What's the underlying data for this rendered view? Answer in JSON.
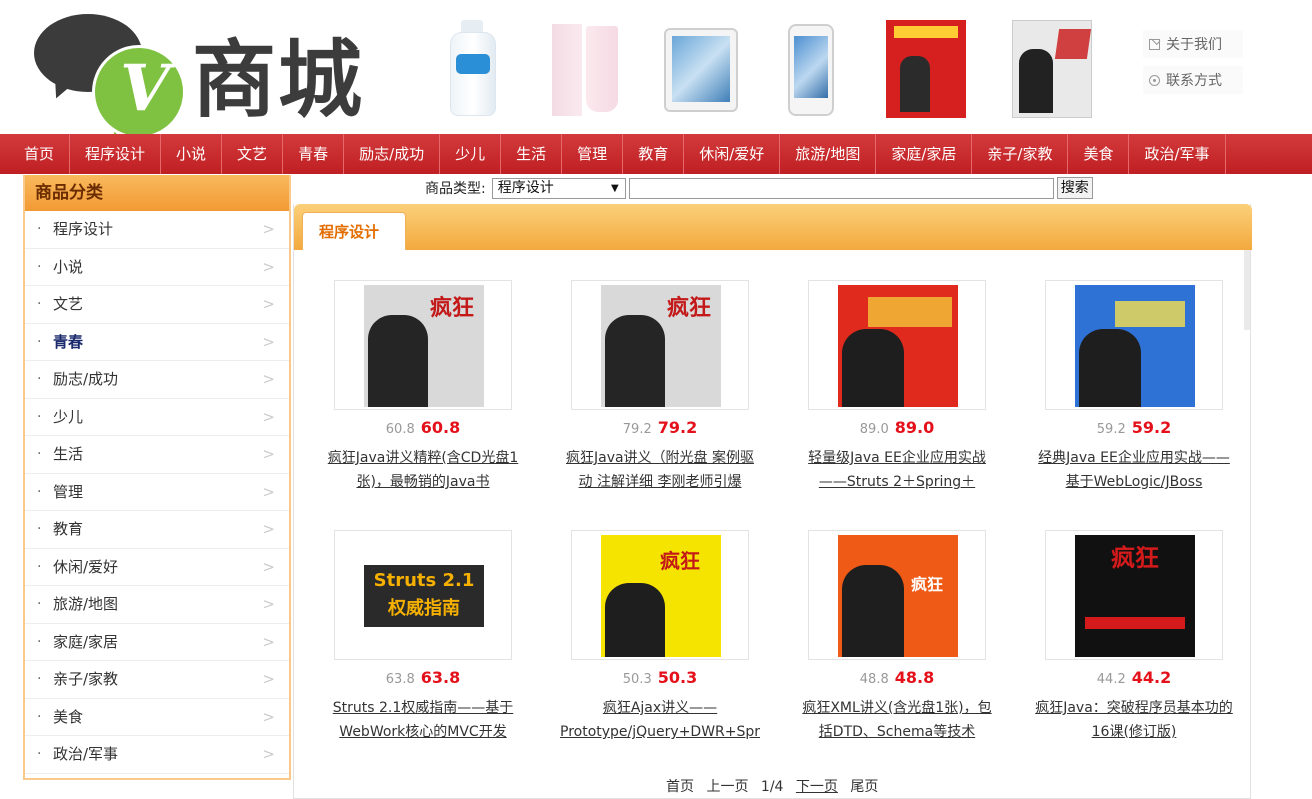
{
  "header": {
    "logo_text": "商城",
    "logo_letter": "V",
    "top_links": [
      {
        "label": "关于我们",
        "icon": "mail-icon"
      },
      {
        "label": "联系方式",
        "icon": "phone-icon"
      }
    ]
  },
  "nav": {
    "items": [
      "首页",
      "程序设计",
      "小说",
      "文艺",
      "青春",
      "励志/成功",
      "少儿",
      "生活",
      "管理",
      "教育",
      "休闲/爱好",
      "旅游/地图",
      "家庭/家居",
      "亲子/家教",
      "美食",
      "政治/军事"
    ]
  },
  "sidebar": {
    "title": "商品分类",
    "items": [
      "程序设计",
      "小说",
      "文艺",
      "青春",
      "励志/成功",
      "少儿",
      "生活",
      "管理",
      "教育",
      "休闲/爱好",
      "旅游/地图",
      "家庭/家居",
      "亲子/家教",
      "美食",
      "政治/军事"
    ],
    "bullet": "·",
    "arrow": ">"
  },
  "search": {
    "label": "商品类型:",
    "selected": "程序设计",
    "value": "",
    "button": "搜索"
  },
  "panel": {
    "tab": "程序设计"
  },
  "products": [
    {
      "old_price": "60.8",
      "price": "60.8",
      "title": "疯狂Java讲义精粹(含CD光盘1张)，最畅销的Java书"
    },
    {
      "old_price": "79.2",
      "price": "79.2",
      "title": "疯狂Java讲义（附光盘 案例驱动 注解详细 李刚老师引爆"
    },
    {
      "old_price": "89.0",
      "price": "89.0",
      "title": "轻量级Java EE企业应用实战——Struts 2＋Spring＋"
    },
    {
      "old_price": "59.2",
      "price": "59.2",
      "title": "经典Java EE企业应用实战——基于WebLogic/JBoss"
    },
    {
      "old_price": "63.8",
      "price": "63.8",
      "title": "Struts 2.1权威指南——基于WebWork核心的MVC开发"
    },
    {
      "old_price": "50.3",
      "price": "50.3",
      "title": "疯狂Ajax讲义——Prototype/jQuery+DWR+Spr"
    },
    {
      "old_price": "48.8",
      "price": "48.8",
      "title": "疯狂XML讲义(含光盘1张)，包括DTD、Schema等技术"
    },
    {
      "old_price": "44.2",
      "price": "44.2",
      "title": "疯狂Java：突破程序员基本功的16课(修订版)"
    }
  ],
  "covers": {
    "c1": "疯狂",
    "c2": "疯狂",
    "c5": "Struts 2.1 权威指南",
    "c6": "疯狂",
    "c7": "疯狂",
    "c8": "疯狂"
  },
  "pager": {
    "first": "首页",
    "prev": "上一页",
    "page": "1/4",
    "next": "下一页",
    "last": "尾页"
  },
  "colors": {
    "nav_red": "#c9282b",
    "accent_orange": "#f3a93e",
    "price_red": "#e4111b",
    "logo_green": "#7fc241"
  }
}
